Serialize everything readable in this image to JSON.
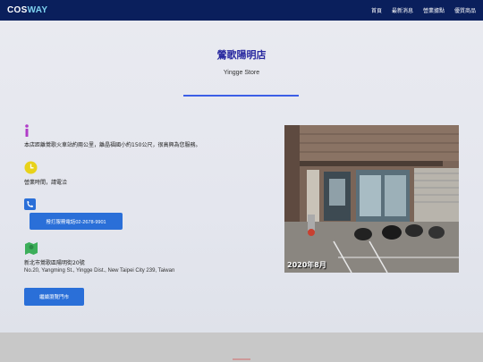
{
  "brand": {
    "logo_main": "COS",
    "logo_accent": "WAY"
  },
  "nav": {
    "items": [
      "首頁",
      "最新消息",
      "營業據點",
      "優質商品"
    ]
  },
  "store": {
    "title": "鶯歌陽明店",
    "subtitle": "Yingge Store"
  },
  "info": {
    "location_text": "本店距離鶯歌火車站約兩公里，離晶福國小約150公尺，很高興為您服務。",
    "hours_text": "營業時間，請電洽",
    "call_button": "撥打服務電話02-2678-9901",
    "address_zh": "新北市鶯歌區陽明街20號",
    "address_en": "No.20, Yangming St., Yingge Dist., New Taipei City 239, Taiwan"
  },
  "back_button": "繼續瀏覽門市",
  "photo": {
    "caption": "2020年8月"
  },
  "colors": {
    "navbar": "#0a1f5c",
    "accent": "#3c5ee6",
    "button": "#2a6fd8",
    "title": "#2a2aa0"
  },
  "icons": {
    "location": "info-icon",
    "hours": "clock-icon",
    "phone": "phone-icon",
    "address": "map-icon"
  }
}
